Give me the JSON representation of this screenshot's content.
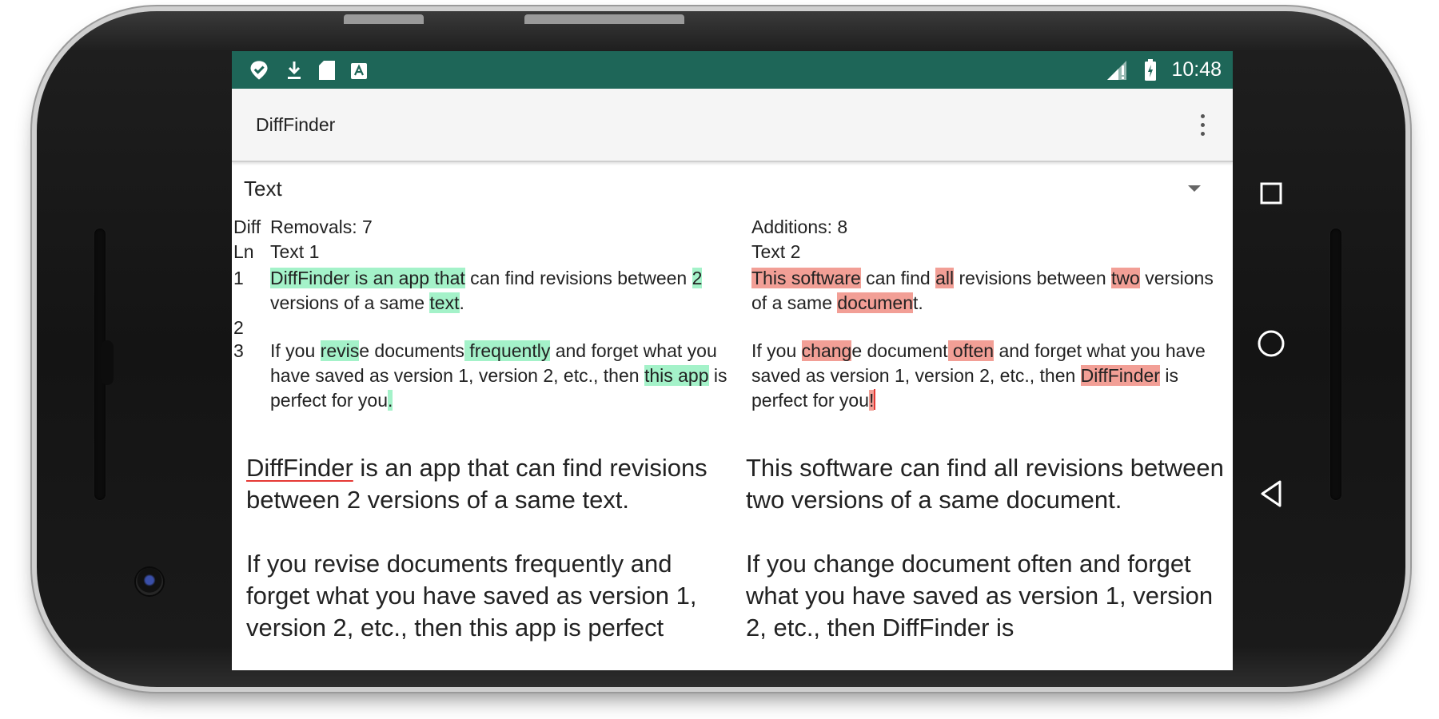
{
  "status_bar": {
    "time": "10:48",
    "left_icons": [
      "vpn-check-icon",
      "download-icon",
      "sd-card-icon",
      "store-icon"
    ],
    "right_icons": [
      "signal-icon",
      "battery-icon"
    ],
    "color": "#1e6658"
  },
  "app_bar": {
    "title": "DiffFinder",
    "menu_icon": "more-vertical-icon"
  },
  "mode_select": {
    "value": "Text"
  },
  "diff": {
    "diff_label": "Diff",
    "removals_label": "Removals: 7",
    "additions_label": "Additions: 8",
    "ln_label": "Ln",
    "left_header": "Text 1",
    "right_header": "Text 2",
    "lines": [
      {
        "ln": "1",
        "left": [
          {
            "t": "DiffFinder is an app that",
            "hl": true
          },
          {
            "t": " can find revisions between ",
            "hl": false
          },
          {
            "t": "2",
            "hl": true
          },
          {
            "t": " versions of a same ",
            "hl": false
          },
          {
            "t": "text",
            "hl": true
          },
          {
            "t": ".",
            "hl": false
          }
        ],
        "right": [
          {
            "t": "This software",
            "hl": true
          },
          {
            "t": " can find ",
            "hl": false
          },
          {
            "t": "all",
            "hl": true
          },
          {
            "t": " revisions between ",
            "hl": false
          },
          {
            "t": "two",
            "hl": true
          },
          {
            "t": " versions of a same ",
            "hl": false
          },
          {
            "t": "documen",
            "hl": true
          },
          {
            "t": "t.",
            "hl": false
          }
        ]
      },
      {
        "ln": "2",
        "left": [],
        "right": []
      },
      {
        "ln": "3",
        "left": [
          {
            "t": "If you ",
            "hl": false
          },
          {
            "t": "revis",
            "hl": true
          },
          {
            "t": "e documents",
            "hl": false
          },
          {
            "t": " frequently",
            "hl": true
          },
          {
            "t": " and forget what you have saved as version 1, version 2, etc., then ",
            "hl": false
          },
          {
            "t": "this app",
            "hl": true
          },
          {
            "t": " is perfect for you",
            "hl": false
          },
          {
            "t": ".",
            "hl": true
          }
        ],
        "right": [
          {
            "t": "If you ",
            "hl": false
          },
          {
            "t": "chang",
            "hl": true
          },
          {
            "t": "e document",
            "hl": false
          },
          {
            "t": " often",
            "hl": true
          },
          {
            "t": " and forget what you have saved as version 1, version 2, etc., then ",
            "hl": false
          },
          {
            "t": "DiffFinder",
            "hl": true
          },
          {
            "t": " is perfect for you",
            "hl": false
          },
          {
            "t": "!",
            "hl": true
          }
        ]
      }
    ],
    "removal_color": "#a4f2c9",
    "addition_color": "#f29f96"
  },
  "editors": {
    "left": {
      "spell_word": "DiffFinder",
      "p1_rest": " is an app that can find revisions between 2 versions of a same text.",
      "p2": "If you revise documents frequently and forget what you have saved as version 1, version 2, etc., then this app is perfect"
    },
    "right": {
      "p1": "This software can find all revisions between two versions of a same document.",
      "p2": "If you change document often and forget what you have saved as version 1, version 2, etc., then DiffFinder is"
    }
  },
  "nav_bar": {
    "icons": [
      "recents-square-icon",
      "home-circle-icon",
      "back-triangle-icon"
    ]
  }
}
